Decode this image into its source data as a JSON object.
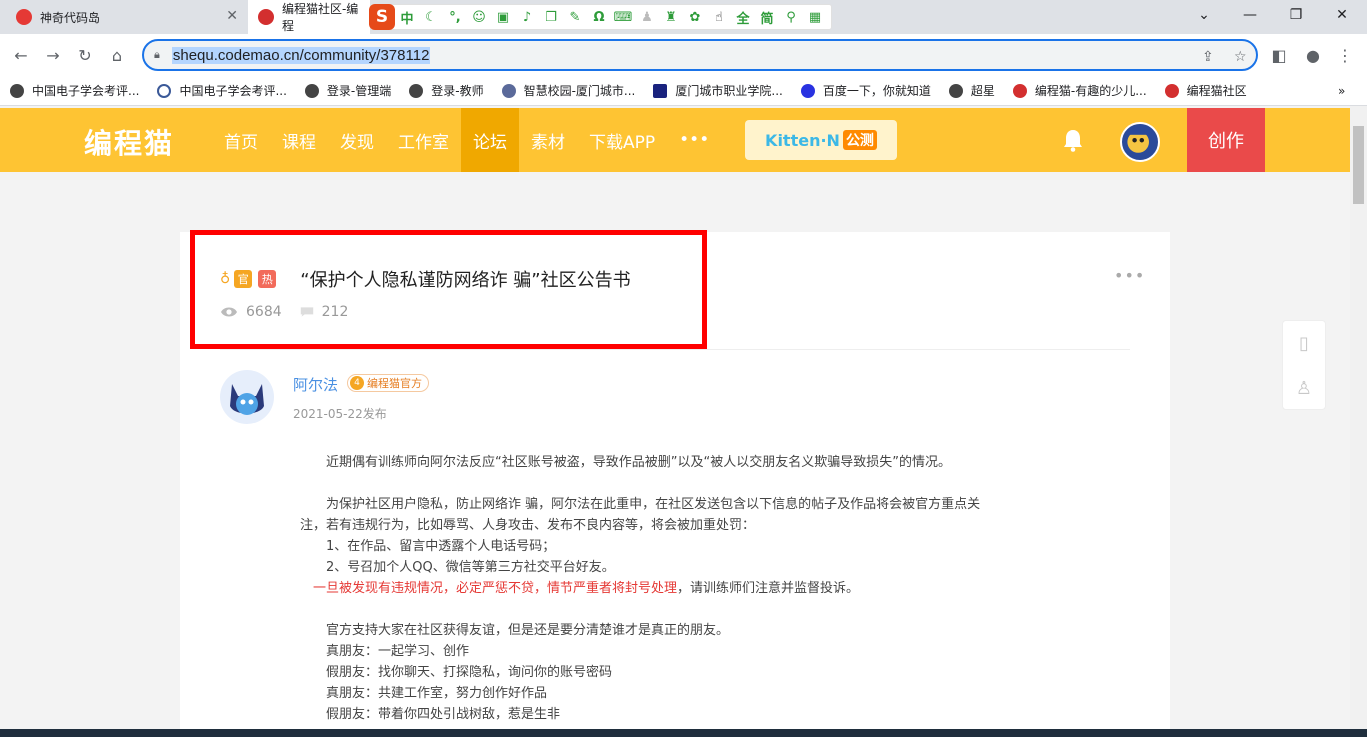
{
  "browser": {
    "tabs": [
      {
        "label": "神奇代码岛",
        "active": false
      },
      {
        "label": "编程猫社区-编程",
        "active": true
      }
    ],
    "url": "shequ.codemao.cn/community/378112",
    "bookmarks": [
      "中国电子学会考评...",
      "中国电子学会考评...",
      "登录-管理端",
      "登录-教师",
      "智慧校园-厦门城市...",
      "厦门城市职业学院...",
      "百度一下，你就知道",
      "超星",
      "编程猫-有趣的少儿...",
      "编程猫社区"
    ],
    "ime": {
      "logo": "S",
      "items": [
        "中",
        "全",
        "简"
      ]
    }
  },
  "site": {
    "logo": "编程猫",
    "nav": [
      "首页",
      "课程",
      "发现",
      "工作室",
      "论坛",
      "素材",
      "下载APP",
      "•••"
    ],
    "active_nav": "论坛",
    "kitten": {
      "label": "Kitten·N",
      "beta": "公测"
    },
    "create_label": "创作"
  },
  "post": {
    "badges": [
      "官",
      "热"
    ],
    "title": "“保护个人隐私谨防网络诈 骗”社区公告书",
    "views": "6684",
    "comments": "212",
    "author": {
      "name": "阿尔法",
      "level": "4",
      "tag": "编程猫官方"
    },
    "date": "2021-05-22发布",
    "body": [
      "　　近期偶有训练师向阿尔法反应“社区账号被盗，导致作品被删”以及“被人以交朋友名义欺骗导致损失”的情况。",
      "",
      "　　为保护社区用户隐私，防止网络诈 骗，阿尔法在此重申，在社区发送包含以下信息的帖子及作品将会被官方重点关",
      "注，若有违规行为，比如辱骂、人身攻击、发布不良内容等，将会被加重处罚：",
      "　　1、在作品、留言中透露个人电话号码；",
      "　　2、号召加个人QQ、微信等第三方社交平台好友。"
    ],
    "warning_red": "一旦被发现有违规情况，必定严惩不贷，情节严重者将封号处理",
    "warning_rest": "，请训练师们注意并监督投诉。",
    "body2": [
      "",
      "　　官方支持大家在社区获得友谊，但是还是要分清楚谁才是真正的朋友。",
      "　　真朋友：一起学习、创作",
      "　　假朋友：找你聊天、打探隐私，询问你的账号密码",
      "　　真朋友：共建工作室，努力创作好作品",
      "　　假朋友：带着你四处引战树敌，惹是生非"
    ]
  },
  "colors": {
    "header": "#fec433",
    "active_nav": "#f0a800",
    "create": "#ea4a4a",
    "highlight": "#ff0000"
  }
}
